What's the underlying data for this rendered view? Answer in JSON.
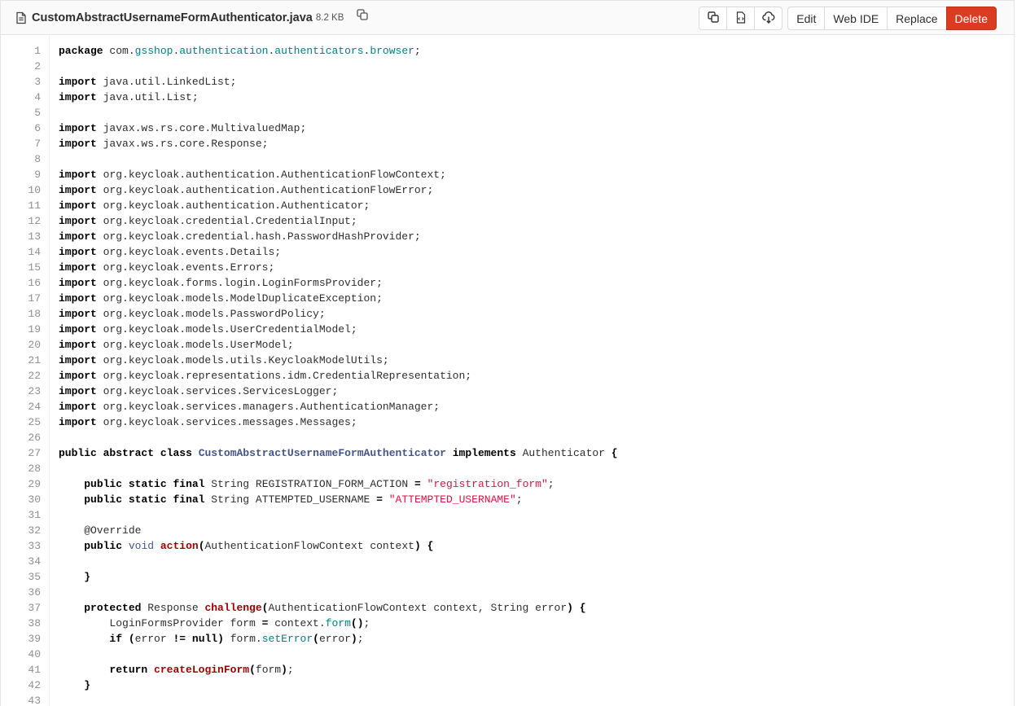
{
  "file": {
    "name": "CustomAbstractUsernameFormAuthenticator.java",
    "size": "8.2 KB"
  },
  "actions": {
    "edit": "Edit",
    "web_ide": "Web IDE",
    "replace": "Replace",
    "delete": "Delete"
  },
  "icons": {
    "file": "file-text-icon",
    "copy_path": "copy-path-icon",
    "copy_contents": "copy-contents-icon",
    "open_raw": "open-raw-icon",
    "download": "download-icon"
  },
  "colors": {
    "delete_button": "#db3b21",
    "keyword": "#000000",
    "string": "#dd1144",
    "class_name": "#445588",
    "function_name": "#990000",
    "package_segment": "#008080"
  },
  "code": {
    "line_numbers": [
      "1",
      "2",
      "3",
      "4",
      "5",
      "6",
      "7",
      "8",
      "9",
      "10",
      "11",
      "12",
      "13",
      "14",
      "15",
      "16",
      "17",
      "18",
      "19",
      "20",
      "21",
      "22",
      "23",
      "24",
      "25",
      "26",
      "27",
      "28",
      "29",
      "30",
      "31",
      "32",
      "33",
      "34",
      "35",
      "36",
      "37",
      "38",
      "39",
      "40",
      "41",
      "42",
      "43"
    ],
    "lines": [
      [
        {
          "t": "package",
          "c": "kw"
        },
        {
          "t": " com."
        },
        {
          "t": "gsshop",
          "c": "teal"
        },
        {
          "t": "."
        },
        {
          "t": "authentication",
          "c": "teal"
        },
        {
          "t": "."
        },
        {
          "t": "authenticators",
          "c": "teal"
        },
        {
          "t": "."
        },
        {
          "t": "browser",
          "c": "teal"
        },
        {
          "t": ";"
        }
      ],
      [],
      [
        {
          "t": "import",
          "c": "kw"
        },
        {
          "t": " java.util.LinkedList;"
        }
      ],
      [
        {
          "t": "import",
          "c": "kw"
        },
        {
          "t": " java.util.List;"
        }
      ],
      [],
      [
        {
          "t": "import",
          "c": "kw"
        },
        {
          "t": " javax.ws.rs.core.MultivaluedMap;"
        }
      ],
      [
        {
          "t": "import",
          "c": "kw"
        },
        {
          "t": " javax.ws.rs.core.Response;"
        }
      ],
      [],
      [
        {
          "t": "import",
          "c": "kw"
        },
        {
          "t": " org.keycloak.authentication.AuthenticationFlowContext;"
        }
      ],
      [
        {
          "t": "import",
          "c": "kw"
        },
        {
          "t": " org.keycloak.authentication.AuthenticationFlowError;"
        }
      ],
      [
        {
          "t": "import",
          "c": "kw"
        },
        {
          "t": " org.keycloak.authentication.Authenticator;"
        }
      ],
      [
        {
          "t": "import",
          "c": "kw"
        },
        {
          "t": " org.keycloak.credential.CredentialInput;"
        }
      ],
      [
        {
          "t": "import",
          "c": "kw"
        },
        {
          "t": " org.keycloak.credential.hash.PasswordHashProvider;"
        }
      ],
      [
        {
          "t": "import",
          "c": "kw"
        },
        {
          "t": " org.keycloak.events.Details;"
        }
      ],
      [
        {
          "t": "import",
          "c": "kw"
        },
        {
          "t": " org.keycloak.events.Errors;"
        }
      ],
      [
        {
          "t": "import",
          "c": "kw"
        },
        {
          "t": " org.keycloak.forms.login.LoginFormsProvider;"
        }
      ],
      [
        {
          "t": "import",
          "c": "kw"
        },
        {
          "t": " org.keycloak.models.ModelDuplicateException;"
        }
      ],
      [
        {
          "t": "import",
          "c": "kw"
        },
        {
          "t": " org.keycloak.models.PasswordPolicy;"
        }
      ],
      [
        {
          "t": "import",
          "c": "kw"
        },
        {
          "t": " org.keycloak.models.UserCredentialModel;"
        }
      ],
      [
        {
          "t": "import",
          "c": "kw"
        },
        {
          "t": " org.keycloak.models.UserModel;"
        }
      ],
      [
        {
          "t": "import",
          "c": "kw"
        },
        {
          "t": " org.keycloak.models.utils.KeycloakModelUtils;"
        }
      ],
      [
        {
          "t": "import",
          "c": "kw"
        },
        {
          "t": " org.keycloak.representations.idm.CredentialRepresentation;"
        }
      ],
      [
        {
          "t": "import",
          "c": "kw"
        },
        {
          "t": " org.keycloak.services.ServicesLogger;"
        }
      ],
      [
        {
          "t": "import",
          "c": "kw"
        },
        {
          "t": " org.keycloak.services.managers.AuthenticationManager;"
        }
      ],
      [
        {
          "t": "import",
          "c": "kw"
        },
        {
          "t": " org.keycloak.services.messages.Messages;"
        }
      ],
      [],
      [
        {
          "t": "public",
          "c": "kw"
        },
        {
          "t": " "
        },
        {
          "t": "abstract",
          "c": "kw"
        },
        {
          "t": " "
        },
        {
          "t": "class",
          "c": "kw"
        },
        {
          "t": " "
        },
        {
          "t": "CustomAbstractUsernameFormAuthenticator",
          "c": "cls"
        },
        {
          "t": " "
        },
        {
          "t": "implements",
          "c": "kw"
        },
        {
          "t": " Authenticator "
        },
        {
          "t": "{",
          "c": "punct"
        }
      ],
      [],
      [
        {
          "t": "    "
        },
        {
          "t": "public",
          "c": "kw"
        },
        {
          "t": " "
        },
        {
          "t": "static",
          "c": "kw"
        },
        {
          "t": " "
        },
        {
          "t": "final",
          "c": "kw"
        },
        {
          "t": " String REGISTRATION_FORM_ACTION "
        },
        {
          "t": "=",
          "c": "punct"
        },
        {
          "t": " "
        },
        {
          "t": "\"registration_form\"",
          "c": "str"
        },
        {
          "t": ";"
        }
      ],
      [
        {
          "t": "    "
        },
        {
          "t": "public",
          "c": "kw"
        },
        {
          "t": " "
        },
        {
          "t": "static",
          "c": "kw"
        },
        {
          "t": " "
        },
        {
          "t": "final",
          "c": "kw"
        },
        {
          "t": " String ATTEMPTED_USERNAME "
        },
        {
          "t": "=",
          "c": "punct"
        },
        {
          "t": " "
        },
        {
          "t": "\"ATTEMPTED_USERNAME\"",
          "c": "str"
        },
        {
          "t": ";"
        }
      ],
      [],
      [
        {
          "t": "    @Override"
        }
      ],
      [
        {
          "t": "    "
        },
        {
          "t": "public",
          "c": "kw"
        },
        {
          "t": " "
        },
        {
          "t": "void",
          "c": "type"
        },
        {
          "t": " "
        },
        {
          "t": "action",
          "c": "fn"
        },
        {
          "t": "(",
          "c": "punct"
        },
        {
          "t": "AuthenticationFlowContext context"
        },
        {
          "t": ")",
          "c": "punct"
        },
        {
          "t": " "
        },
        {
          "t": "{",
          "c": "punct"
        }
      ],
      [],
      [
        {
          "t": "    "
        },
        {
          "t": "}",
          "c": "punct"
        }
      ],
      [],
      [
        {
          "t": "    "
        },
        {
          "t": "protected",
          "c": "kw"
        },
        {
          "t": " Response "
        },
        {
          "t": "challenge",
          "c": "fn"
        },
        {
          "t": "(",
          "c": "punct"
        },
        {
          "t": "AuthenticationFlowContext context, String error"
        },
        {
          "t": ")",
          "c": "punct"
        },
        {
          "t": " "
        },
        {
          "t": "{",
          "c": "punct"
        }
      ],
      [
        {
          "t": "        LoginFormsProvider form "
        },
        {
          "t": "=",
          "c": "punct"
        },
        {
          "t": " context."
        },
        {
          "t": "form",
          "c": "teal"
        },
        {
          "t": "()",
          "c": "punct"
        },
        {
          "t": ";"
        }
      ],
      [
        {
          "t": "        "
        },
        {
          "t": "if",
          "c": "kw"
        },
        {
          "t": " "
        },
        {
          "t": "(",
          "c": "punct"
        },
        {
          "t": "error "
        },
        {
          "t": "!=",
          "c": "punct"
        },
        {
          "t": " "
        },
        {
          "t": "null",
          "c": "kw"
        },
        {
          "t": ")",
          "c": "punct"
        },
        {
          "t": " form."
        },
        {
          "t": "setError",
          "c": "teal"
        },
        {
          "t": "(",
          "c": "punct"
        },
        {
          "t": "error"
        },
        {
          "t": ")",
          "c": "punct"
        },
        {
          "t": ";"
        }
      ],
      [],
      [
        {
          "t": "        "
        },
        {
          "t": "return",
          "c": "kw"
        },
        {
          "t": " "
        },
        {
          "t": "createLoginForm",
          "c": "fn"
        },
        {
          "t": "(",
          "c": "punct"
        },
        {
          "t": "form"
        },
        {
          "t": ")",
          "c": "punct"
        },
        {
          "t": ";"
        }
      ],
      [
        {
          "t": "    "
        },
        {
          "t": "}",
          "c": "punct"
        }
      ],
      []
    ]
  }
}
